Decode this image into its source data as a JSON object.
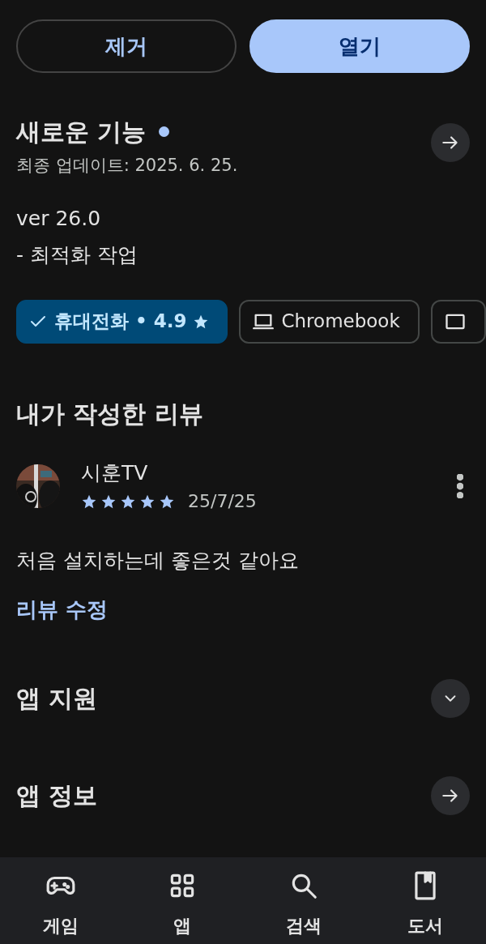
{
  "actions": [
    {
      "label": "제거",
      "kind": "outline"
    },
    {
      "label": "열기",
      "kind": "filled"
    }
  ],
  "whats_new": {
    "title": "새로운 기능",
    "new_dot": true,
    "updated": "최종 업데이트: 2025. 6. 25.",
    "version": "ver 26.0",
    "notes": "- 최적화 작업"
  },
  "devices": [
    {
      "label": "휴대전화 • 4.9",
      "kind": "phone",
      "selected": true
    },
    {
      "label": "Chromebook",
      "kind": "laptop",
      "selected": false
    },
    {
      "kind": "tablet",
      "selected": false
    }
  ],
  "my_review": {
    "heading": "내가 작성한 리뷰",
    "author": "시훈TV",
    "stars": 5,
    "date": "25/7/25",
    "text": "처음 설치하는데 좋은것 같아요",
    "edit_link": "리뷰 수정"
  },
  "sections": [
    {
      "title": "앱 지원",
      "kind": "expand"
    },
    {
      "title": "앱 정보",
      "kind": "arrow"
    }
  ],
  "bottom_nav": [
    {
      "label": "게임",
      "kind": "gamepad"
    },
    {
      "label": "앱",
      "kind": "apps"
    },
    {
      "label": "검색",
      "kind": "search"
    },
    {
      "label": "도서",
      "kind": "book"
    }
  ]
}
